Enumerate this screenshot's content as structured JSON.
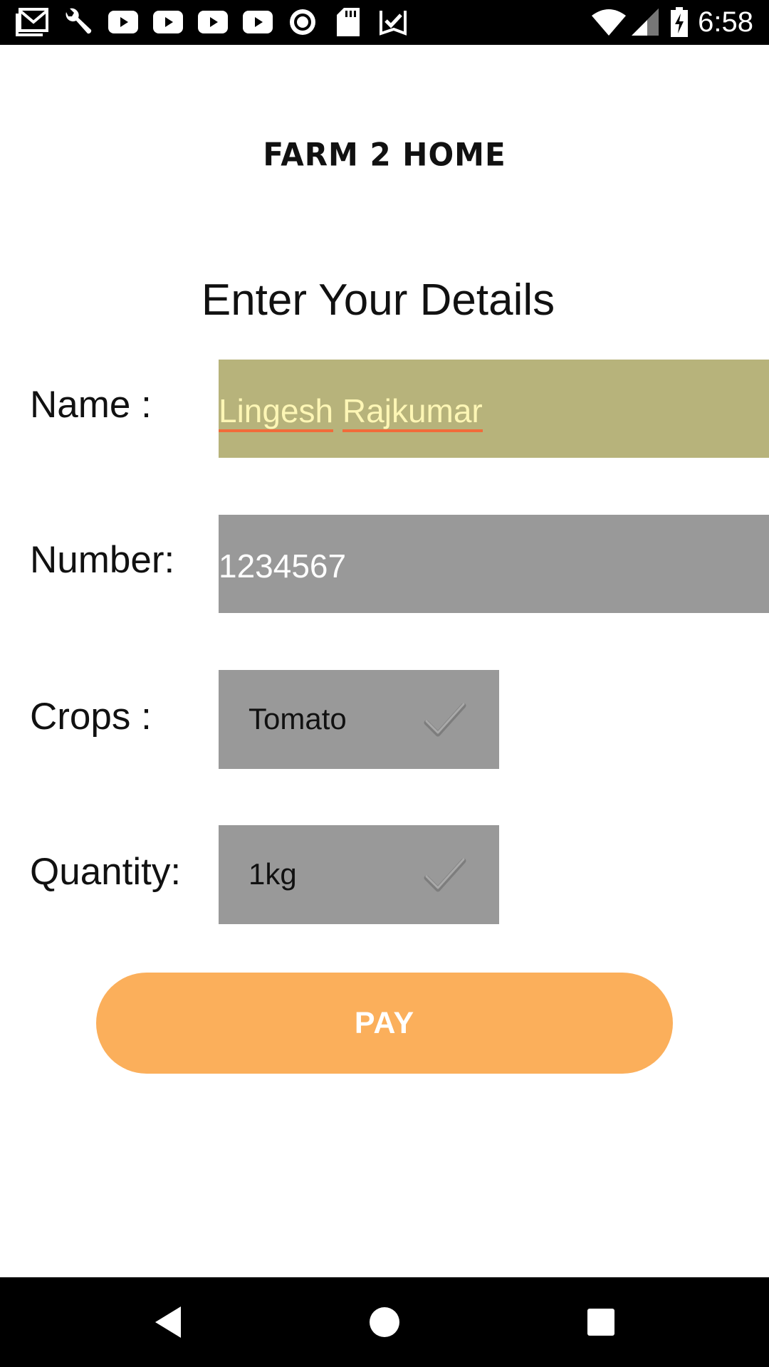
{
  "status_bar": {
    "time": "6:58",
    "notification_icons": [
      "gmail-icon",
      "wrench-icon",
      "youtube-icon",
      "youtube-icon",
      "youtube-icon",
      "youtube-icon",
      "record-icon",
      "sd-card-icon",
      "check-square-icon"
    ],
    "system_icons": [
      "wifi-icon",
      "cell-signal-icon",
      "battery-charging-icon"
    ]
  },
  "app": {
    "logo": "FARM 2 HOME",
    "heading": "Enter Your Details"
  },
  "form": {
    "name": {
      "label": "Name :",
      "value_first": "Lingesh",
      "value_last": "Rajkumar"
    },
    "number": {
      "label": "Number:",
      "value": "1234567"
    },
    "crops": {
      "label": "Crops :",
      "selected": "Tomato"
    },
    "quantity": {
      "label": "Quantity:",
      "selected": "1kg"
    }
  },
  "pay_button": {
    "label": "PAY"
  },
  "colors": {
    "name_field_bg": "#b7b37b",
    "field_bg": "#999999",
    "pay_bg": "#fbaf5b",
    "spell_underline": "#f26b3a"
  }
}
